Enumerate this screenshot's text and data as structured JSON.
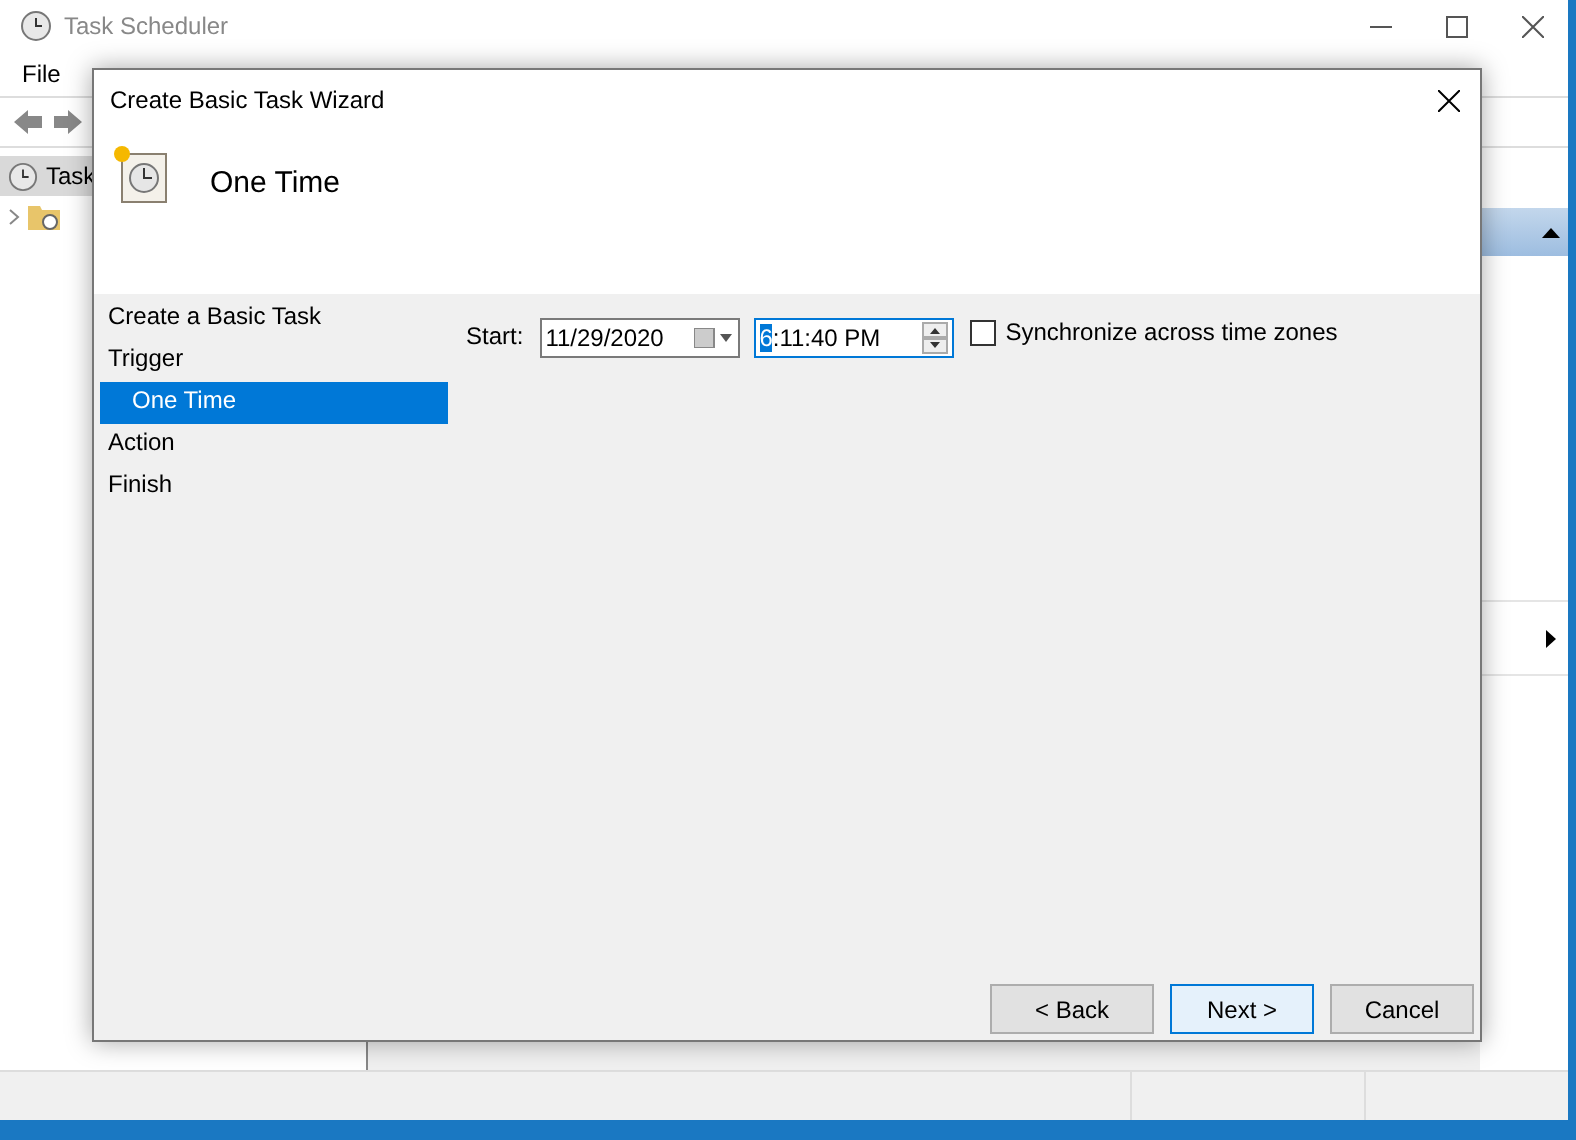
{
  "main_window": {
    "title": "Task Scheduler",
    "menu": [
      "File"
    ],
    "tree": [
      {
        "label": "Task",
        "selected": true
      }
    ]
  },
  "wizard": {
    "title": "Create Basic Task Wizard",
    "heading": "One Time",
    "steps": [
      {
        "label": "Create a Basic Task",
        "selected": false
      },
      {
        "label": "Trigger",
        "selected": false,
        "children": [
          {
            "label": "One Time",
            "selected": true
          }
        ]
      },
      {
        "label": "Action",
        "selected": false
      },
      {
        "label": "Finish",
        "selected": false
      }
    ],
    "start_label": "Start:",
    "date": "11/29/2020",
    "time": {
      "hour": "6",
      "rest": ":11:40 PM"
    },
    "sync_checkbox": {
      "label": "Synchronize across time zones",
      "checked": false
    },
    "buttons": [
      {
        "label": "< Back",
        "default": false
      },
      {
        "label": "Next >",
        "default": true
      },
      {
        "label": "Cancel",
        "default": false
      }
    ]
  }
}
